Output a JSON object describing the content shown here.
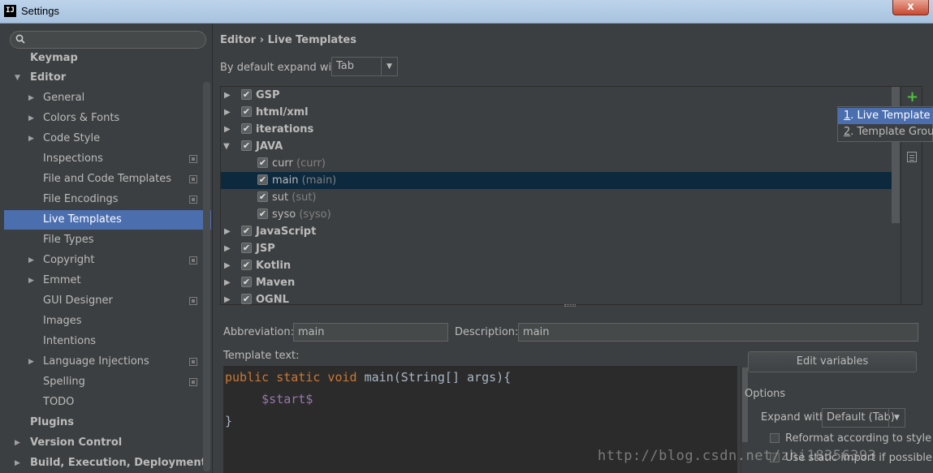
{
  "window": {
    "title": "Settings",
    "app_icon_text": "IJ",
    "close_label": "x"
  },
  "sidebar": {
    "search_placeholder": "",
    "items": [
      {
        "label": "Keymap"
      },
      {
        "label": "Editor"
      },
      {
        "label": "General"
      },
      {
        "label": "Colors & Fonts"
      },
      {
        "label": "Code Style"
      },
      {
        "label": "Inspections"
      },
      {
        "label": "File and Code Templates"
      },
      {
        "label": "File Encodings"
      },
      {
        "label": "Live Templates"
      },
      {
        "label": "File Types"
      },
      {
        "label": "Copyright"
      },
      {
        "label": "Emmet"
      },
      {
        "label": "GUI Designer"
      },
      {
        "label": "Images"
      },
      {
        "label": "Intentions"
      },
      {
        "label": "Language Injections"
      },
      {
        "label": "Spelling"
      },
      {
        "label": "TODO"
      },
      {
        "label": "Plugins"
      },
      {
        "label": "Version Control"
      },
      {
        "label": "Build, Execution, Deployment"
      }
    ]
  },
  "main": {
    "breadcrumb": "Editor › Live Templates",
    "expand_label": "By default expand with",
    "expand_value": "Tab",
    "groups": [
      {
        "label": "GSP"
      },
      {
        "label": "html/xml"
      },
      {
        "label": "iterations"
      },
      {
        "label": "JAVA"
      },
      {
        "label": "curr",
        "desc": "(curr)"
      },
      {
        "label": "main",
        "desc": "(main)"
      },
      {
        "label": "sut",
        "desc": "(sut)"
      },
      {
        "label": "syso",
        "desc": "(syso)"
      },
      {
        "label": "JavaScript"
      },
      {
        "label": "JSP"
      },
      {
        "label": "Kotlin"
      },
      {
        "label": "Maven"
      },
      {
        "label": "OGNL"
      }
    ],
    "popup": {
      "items": [
        {
          "num": "1",
          "label": ". Live Template"
        },
        {
          "num": "2",
          "label": ". Template Group..."
        }
      ]
    },
    "abbreviation_label": "Abbreviation:",
    "abbreviation_value": "main",
    "description_label": "Description:",
    "description_value": "main",
    "template_text_label": "Template text:",
    "code": {
      "line1_kw": "public static void ",
      "line1_rest": "main(String[] args){",
      "line2": "$start$",
      "line3": "}"
    },
    "edit_variables_label": "Edit variables",
    "options_label": "Options",
    "expand_with_label": "Expand with",
    "expand_with_value": "Default (Tab)",
    "reformat_label": "Reformat according to style",
    "static_import_label": "Use static import if possible"
  },
  "watermark": "http://blog.csdn.net/zhi18356393",
  "colors": {
    "selection": "#4b6eaf",
    "tree_selection": "#0d293e",
    "background": "#3c3f41",
    "add_icon": "#4ec23d"
  }
}
